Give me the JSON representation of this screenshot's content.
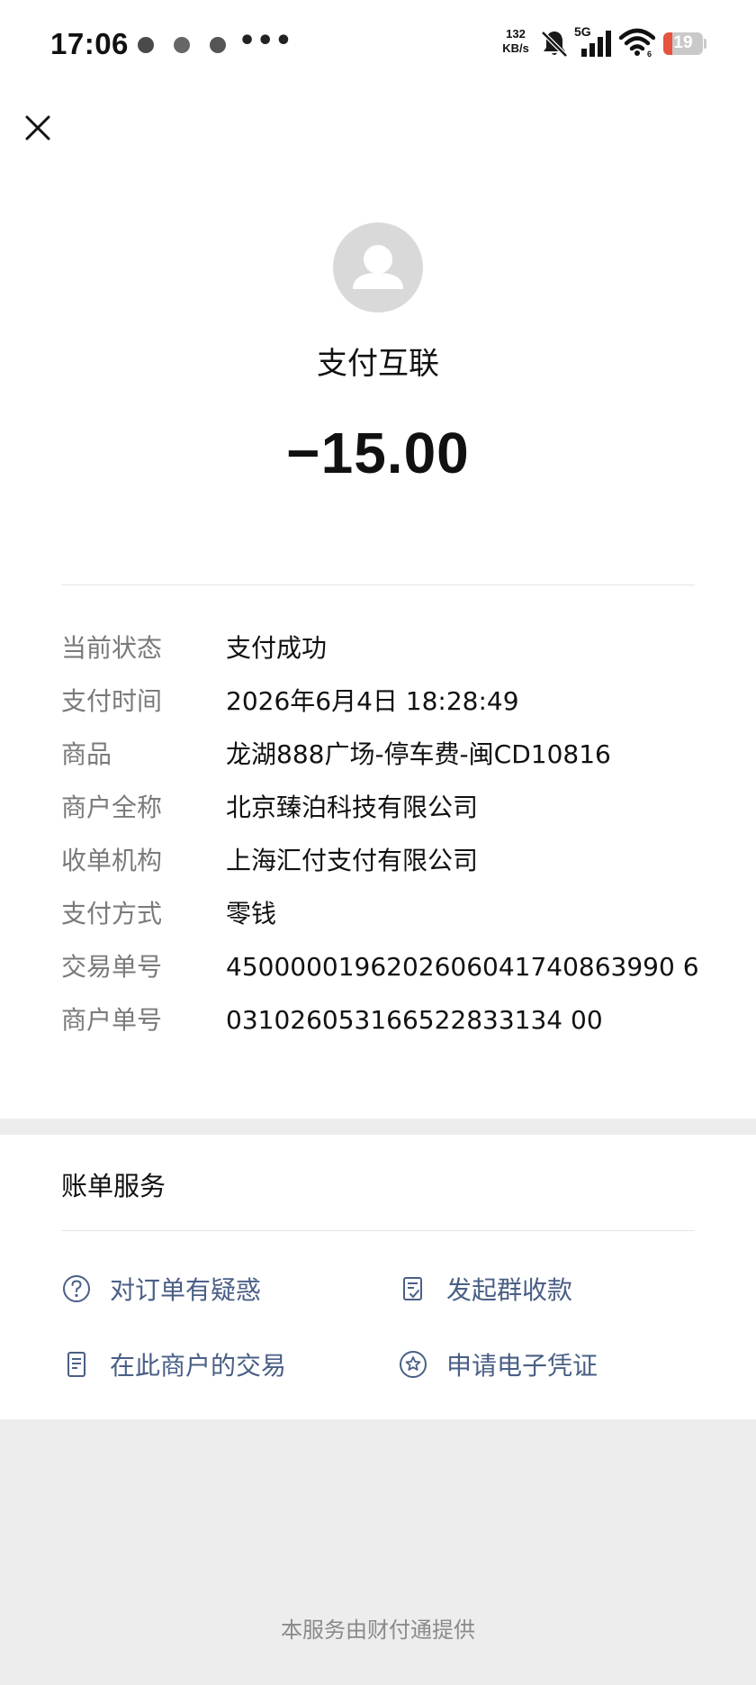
{
  "status_bar": {
    "time": "17:06",
    "more": "•••",
    "net_speed_value": "132",
    "net_speed_unit": "KB/s",
    "network_type": "5G",
    "battery_level": "19"
  },
  "header": {
    "close_icon": "close-icon"
  },
  "merchant": {
    "name": "支付互联",
    "avatar_icon": "user-silhouette-icon"
  },
  "amount": "−15.00",
  "details": [
    {
      "label": "当前状态",
      "value": "支付成功"
    },
    {
      "label": "支付时间",
      "value": "2026年6月4日 18:28:49"
    },
    {
      "label": "商品",
      "value": "龙湖888广场-停车费-闽CD10816"
    },
    {
      "label": "商户全称",
      "value": "北京臻泊科技有限公司"
    },
    {
      "label": "收单机构",
      "value": "上海汇付支付有限公司"
    },
    {
      "label": "支付方式",
      "value": "零钱"
    },
    {
      "label": "交易单号",
      "value": "4500000196202606041740863990 6"
    },
    {
      "label": "商户单号",
      "value": "031026053166522833134 00"
    }
  ],
  "services": {
    "title": "账单服务",
    "items": [
      {
        "label": "对订单有疑惑",
        "icon": "question-circle-icon"
      },
      {
        "label": "发起群收款",
        "icon": "group-collect-icon"
      },
      {
        "label": "在此商户的交易",
        "icon": "document-list-icon"
      },
      {
        "label": "申请电子凭证",
        "icon": "star-badge-icon"
      }
    ]
  },
  "footer": {
    "text": "本服务由财付通提供"
  },
  "colors": {
    "link_blue": "#4a5f86",
    "label_gray": "#7a7a7a",
    "background": "#ededed",
    "battery_low": "#e8523f"
  }
}
